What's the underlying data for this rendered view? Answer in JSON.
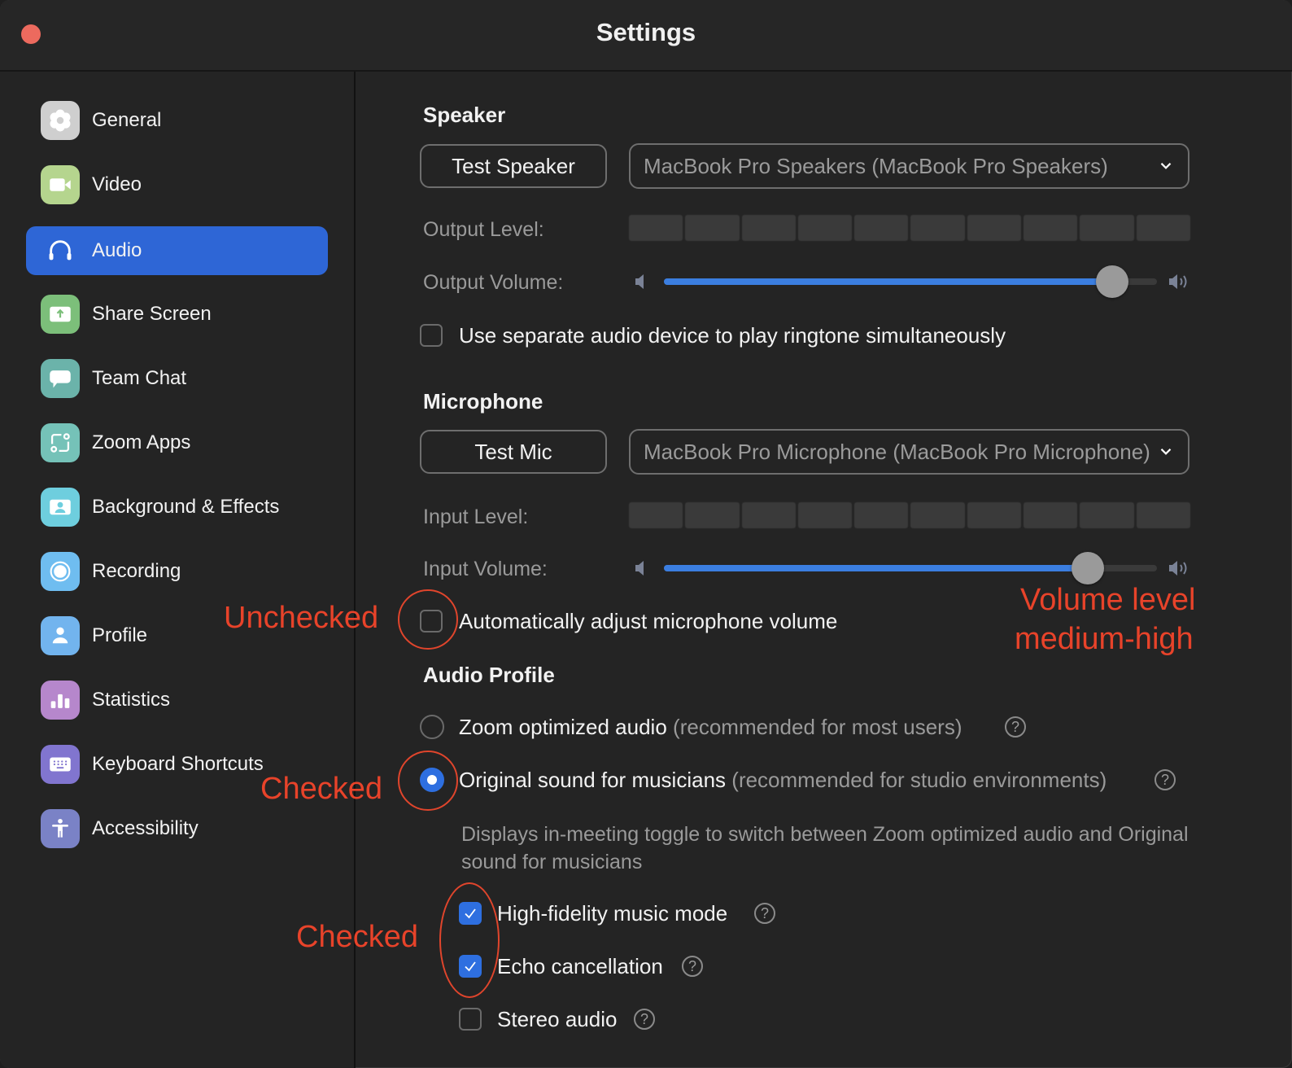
{
  "window": {
    "title": "Settings",
    "close_color": "#ec6a5e"
  },
  "sidebar": {
    "active_index": 2,
    "items": [
      {
        "label": "General",
        "icon": "gear-icon",
        "color": "#cfcfcf"
      },
      {
        "label": "Video",
        "icon": "video-camera-icon",
        "color": "#b5d58e"
      },
      {
        "label": "Audio",
        "icon": "headphones-icon",
        "color": "#2e66d6"
      },
      {
        "label": "Share Screen",
        "icon": "share-screen-icon",
        "color": "#7cbf7a"
      },
      {
        "label": "Team Chat",
        "icon": "chat-bubble-icon",
        "color": "#6bb3aa"
      },
      {
        "label": "Zoom Apps",
        "icon": "apps-icon",
        "color": "#75c2b8"
      },
      {
        "label": "Background & Effects",
        "icon": "background-icon",
        "color": "#6ecede"
      },
      {
        "label": "Recording",
        "icon": "record-icon",
        "color": "#6fbdf0"
      },
      {
        "label": "Profile",
        "icon": "person-icon",
        "color": "#72b4ee"
      },
      {
        "label": "Statistics",
        "icon": "bar-chart-icon",
        "color": "#b687cc"
      },
      {
        "label": "Keyboard Shortcuts",
        "icon": "keyboard-icon",
        "color": "#8175cf"
      },
      {
        "label": "Accessibility",
        "icon": "accessibility-icon",
        "color": "#7a82c6"
      }
    ]
  },
  "speaker": {
    "title": "Speaker",
    "test_button": "Test Speaker",
    "device": "MacBook Pro Speakers (MacBook Pro Speakers)",
    "output_level_label": "Output Level:",
    "output_level_segments": 10,
    "output_level_active": 0,
    "output_volume_label": "Output Volume:",
    "output_volume": 0.91,
    "ringtone_checkbox": {
      "label": "Use separate audio device to play ringtone simultaneously",
      "checked": false
    }
  },
  "microphone": {
    "title": "Microphone",
    "test_button": "Test Mic",
    "device": "MacBook Pro Microphone (MacBook Pro Microphone)",
    "input_level_label": "Input Level:",
    "input_level_segments": 10,
    "input_level_active": 0,
    "input_volume_label": "Input Volume:",
    "input_volume": 0.86,
    "auto_adjust_checkbox": {
      "label": "Automatically adjust microphone volume",
      "checked": false
    }
  },
  "audio_profile": {
    "title": "Audio Profile",
    "options": [
      {
        "label": "Zoom optimized audio",
        "hint": "(recommended for most users)",
        "selected": false
      },
      {
        "label": "Original sound for musicians",
        "hint": "(recommended for studio environments)",
        "selected": true
      }
    ],
    "description": "Displays in-meeting toggle to switch between Zoom optimized audio and Original sound for musicians",
    "sub_options": [
      {
        "label": "High-fidelity music mode",
        "checked": true
      },
      {
        "label": "Echo cancellation",
        "checked": true
      },
      {
        "label": "Stereo audio",
        "checked": false
      }
    ],
    "help_glyph": "?"
  },
  "annotations": {
    "unchecked": "Unchecked",
    "checked_radio": "Checked",
    "checked_boxes": "Checked",
    "volume_line1": "Volume level",
    "volume_line2": "medium-high",
    "color": "#e8432a"
  }
}
